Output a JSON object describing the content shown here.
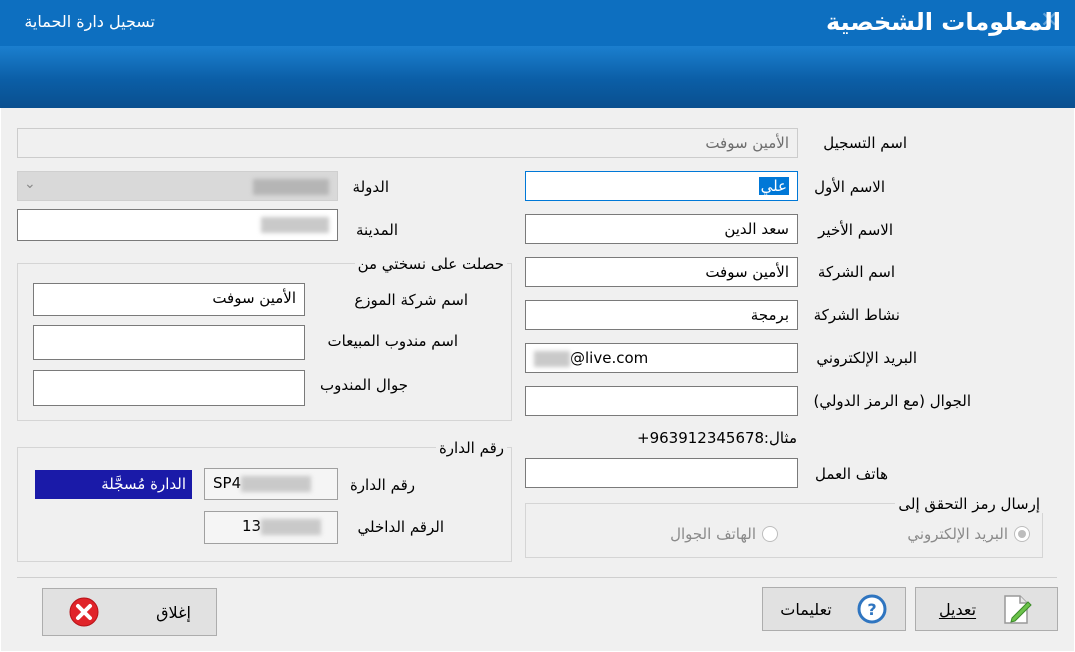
{
  "window": {
    "title": "تسجيل دارة الحماية",
    "close_glyph": "✕"
  },
  "header": {
    "title": "المعلومات الشخصية"
  },
  "registration": {
    "label": "اسم التسجيل",
    "value": "الأمين سوفت"
  },
  "first_name": {
    "label": "الاسم الأول",
    "value": "علي"
  },
  "last_name": {
    "label": "الاسم الأخير",
    "value": "سعد الدين"
  },
  "company_name": {
    "label": "اسم الشركة",
    "value": "الأمين سوفت"
  },
  "company_activity": {
    "label": "نشاط الشركة",
    "value": "برمجة"
  },
  "email": {
    "label": "البريد الإلكتروني",
    "value_visible": "@live.com"
  },
  "mobile": {
    "label": "الجوال (مع الرمز الدولي)",
    "value": ""
  },
  "example": {
    "label": "مثال:",
    "value": "+963912345678"
  },
  "work_phone": {
    "label": "هاتف العمل",
    "value": ""
  },
  "country": {
    "label": "الدولة",
    "arrow": "⌄"
  },
  "city": {
    "label": "المدينة"
  },
  "copy_group": {
    "title": "حصلت على نسختي من",
    "distributor_label": "اسم شركة الموزع",
    "distributor_value": "الأمين سوفت",
    "sales_rep_label": "اسم مندوب المبيعات",
    "sales_rep_value": "",
    "rep_mobile_label": "جوال المندوب",
    "rep_mobile_value": ""
  },
  "circuit_group": {
    "title": "رقم الدارة",
    "circuit_label": "رقم الدارة",
    "circuit_value_visible": "SP4",
    "internal_label": "الرقم الداخلي",
    "internal_value_visible": "13",
    "status": "الدارة مُسجَّلة"
  },
  "verify_group": {
    "title": "إرسال رمز التحقق إلى",
    "email_option": "البريد الإلكتروني",
    "mobile_option": "الهاتف الجوال",
    "selected": "email"
  },
  "buttons": {
    "edit": "تعديل",
    "help": "تعليمات",
    "close": "إغلاق"
  },
  "colors": {
    "title_bar": "#0d6fc0",
    "status_fill": "#1a1aa8",
    "close_icon": "#e0242a",
    "help_icon": "#2f75c0"
  }
}
